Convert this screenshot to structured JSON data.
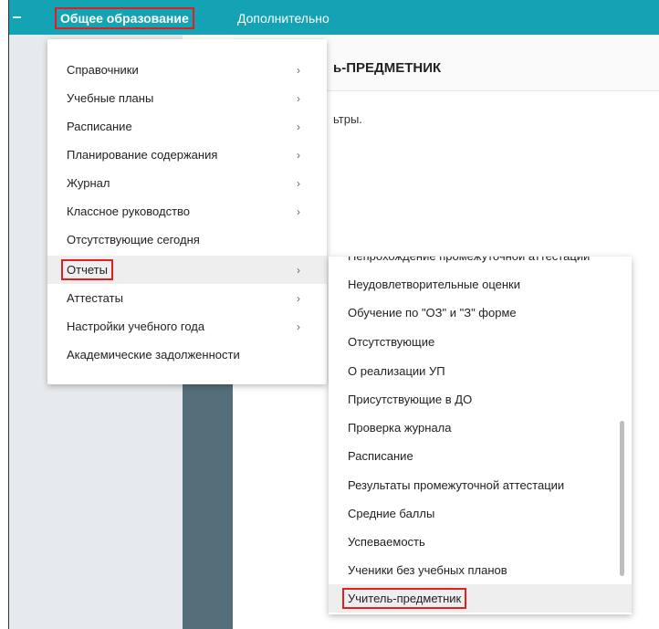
{
  "topbar": {
    "nav_main": "Общее образование",
    "nav_extra": "Дополнительно"
  },
  "page": {
    "title_fragment": "ь-ПРЕДМЕТНИК",
    "subtitle_fragment": "ьтры."
  },
  "dropdown": {
    "items": [
      {
        "label": "Справочники",
        "chevron": "›"
      },
      {
        "label": "Учебные планы",
        "chevron": "›"
      },
      {
        "label": "Расписание",
        "chevron": "›"
      },
      {
        "label": "Планирование содержания",
        "chevron": "›"
      },
      {
        "label": "Журнал",
        "chevron": "›"
      },
      {
        "label": "Классное руководство",
        "chevron": "›"
      },
      {
        "label": "Отсутствующие сегодня",
        "chevron": ""
      },
      {
        "label": "Отчеты",
        "chevron": "›"
      },
      {
        "label": "Аттестаты",
        "chevron": "›"
      },
      {
        "label": "Настройки учебного года",
        "chevron": "›"
      },
      {
        "label": "Академические задолженности",
        "chevron": ""
      }
    ]
  },
  "submenu": {
    "items": [
      "Непрохождение промежуточной аттестации",
      "Неудовлетворительные оценки",
      "Обучение по \"ОЗ\" и \"З\" форме",
      "Отсутствующие",
      "О реализации УП",
      "Присутствующие в ДО",
      "Проверка журнала",
      "Расписание",
      "Результаты промежуточной аттестации",
      "Средние баллы",
      "Успеваемость",
      "Ученики без учебных планов",
      "Учитель-предметник"
    ]
  },
  "colors": {
    "topbar": "#13a3b5",
    "highlight_border": "#e02020",
    "side_strip": "#546e7a"
  }
}
